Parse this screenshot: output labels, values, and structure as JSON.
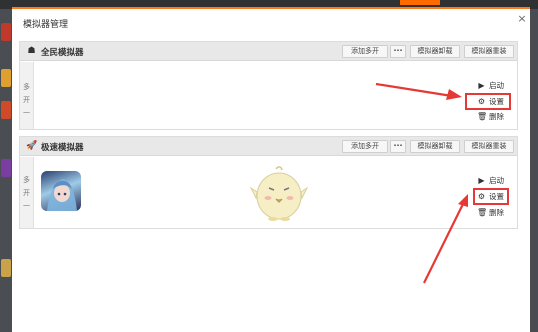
{
  "dialog": {
    "title": "模拟器管理",
    "close_glyph": "×"
  },
  "groups": [
    {
      "name": "全民模拟器",
      "icon": "android-icon",
      "icon_glyph": "☗",
      "side_label": [
        "多",
        "开",
        "一"
      ],
      "buttons": {
        "add": "添加多开",
        "more1": "···",
        "uninstall": "模拟器卸载",
        "more2": "···",
        "repair": "模拟器重装",
        "more3": "···"
      },
      "actions": {
        "start": "启动",
        "settings": "设置",
        "delete": "删除"
      }
    },
    {
      "name": "极速模拟器",
      "icon": "rocket-icon",
      "icon_glyph": "🚀",
      "side_label": [
        "多",
        "开",
        "一"
      ],
      "buttons": {
        "add": "添加多开",
        "more1": "···",
        "uninstall": "模拟器卸载",
        "more2": "···",
        "repair": "模拟器重装",
        "more3": "···"
      },
      "actions": {
        "start": "启动",
        "settings": "设置",
        "delete": "删除"
      }
    }
  ],
  "icons": {
    "play": "▶",
    "gear": "⚙",
    "trash": "🗑"
  },
  "colors": {
    "accent": "#ff7a1a",
    "highlight": "#e53935"
  }
}
